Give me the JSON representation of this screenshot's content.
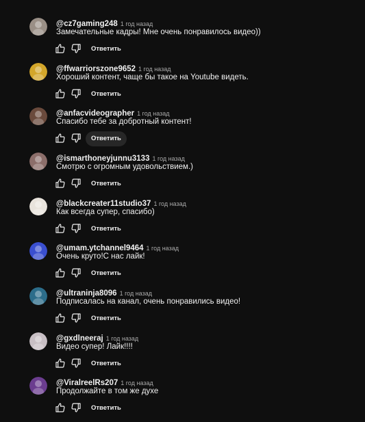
{
  "comments": [
    {
      "author": "@cz7gaming248",
      "time": "1 год назад",
      "text": "Замечательные кадры! Мне очень понравилось видео))",
      "reply_label": "Ответить",
      "avatar_color": "#9a8f86",
      "reply_hover": false
    },
    {
      "author": "@ffwarriorszone9652",
      "time": "1 год назад",
      "text": "Хороший контент, чаще бы такое на Youtube видеть.",
      "reply_label": "Ответить",
      "avatar_color": "#d3a62a",
      "reply_hover": false
    },
    {
      "author": "@anfacvideographer",
      "time": "1 год назад",
      "text": "Спасибо тебе за добротный контент!",
      "reply_label": "Ответить",
      "avatar_color": "#6a4a3c",
      "reply_hover": true
    },
    {
      "author": "@ismarthoneyjunnu3133",
      "time": "1 год назад",
      "text": "Смотрю с огромным удовольствием.)",
      "reply_label": "Ответить",
      "avatar_color": "#8c6e6a",
      "reply_hover": false
    },
    {
      "author": "@blackcreater11studio37",
      "time": "1 год назад",
      "text": "Как всегда супер, спасибо)",
      "reply_label": "Ответить",
      "avatar_color": "#e8e3dc",
      "reply_hover": false
    },
    {
      "author": "@umam.ytchannel9464",
      "time": "1 год назад",
      "text": "Очень круто!С нас лайк!",
      "reply_label": "Ответить",
      "avatar_color": "#3a4fd0",
      "reply_hover": false
    },
    {
      "author": "@ultraninja8096",
      "time": "1 год назад",
      "text": "Подписалась на канал, очень понравились видео!",
      "reply_label": "Ответить",
      "avatar_color": "#2c6d8a",
      "reply_hover": false
    },
    {
      "author": "@gxdlneeraj",
      "time": "1 год назад",
      "text": "Видео супер! Лайк!!!!",
      "reply_label": "Ответить",
      "avatar_color": "#c8bfc4",
      "reply_hover": false
    },
    {
      "author": "@ViralreelRs207",
      "time": "1 год назад",
      "text": "Продолжайте в том же духе",
      "reply_label": "Ответить",
      "avatar_color": "#6b3d8f",
      "reply_hover": false
    }
  ],
  "icons": {
    "like": "thumbs-up-icon",
    "dislike": "thumbs-down-icon"
  }
}
